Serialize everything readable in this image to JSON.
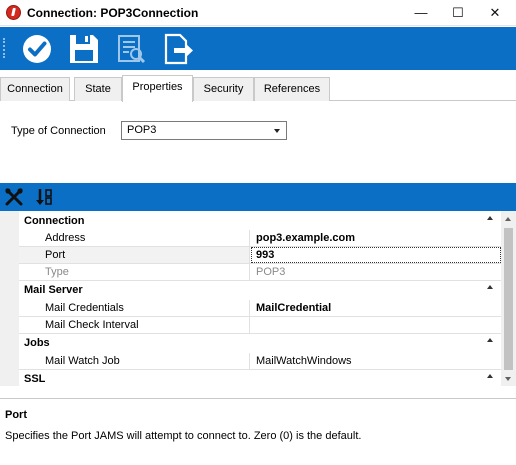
{
  "window": {
    "title": "Connection: POP3Connection"
  },
  "window_controls": {
    "minimize": "—",
    "maximize": "☐",
    "close": "✕"
  },
  "toolbar": {
    "accent": "#0b6fc6",
    "buttons": [
      "check-icon",
      "save-icon",
      "preview-icon",
      "export-icon"
    ]
  },
  "tabs": [
    {
      "label": "Connection",
      "active": false
    },
    {
      "label": "State",
      "active": false
    },
    {
      "label": "Properties",
      "active": true
    },
    {
      "label": "Security",
      "active": false
    },
    {
      "label": "References",
      "active": false
    }
  ],
  "type_of_connection": {
    "label": "Type of Connection",
    "value": "POP3"
  },
  "property_grid": {
    "toolbar": [
      "wrench-icon",
      "sort-icon"
    ],
    "categories": [
      {
        "name": "Connection",
        "rows": [
          {
            "name": "Address",
            "value": "pop3.example.com"
          },
          {
            "name": "Port",
            "value": "993"
          },
          {
            "name": "Type",
            "value": "POP3"
          }
        ]
      },
      {
        "name": "Mail Server",
        "rows": [
          {
            "name": "Mail Credentials",
            "value": "MailCredential"
          },
          {
            "name": "Mail Check Interval",
            "value": ""
          }
        ]
      },
      {
        "name": "Jobs",
        "rows": [
          {
            "name": "Mail Watch Job",
            "value": "MailWatchWindows"
          }
        ]
      },
      {
        "name": "SSL",
        "rows": []
      }
    ]
  },
  "help": {
    "title": "Port",
    "description": "Specifies the Port JAMS will attempt to connect to. Zero (0) is the default."
  }
}
